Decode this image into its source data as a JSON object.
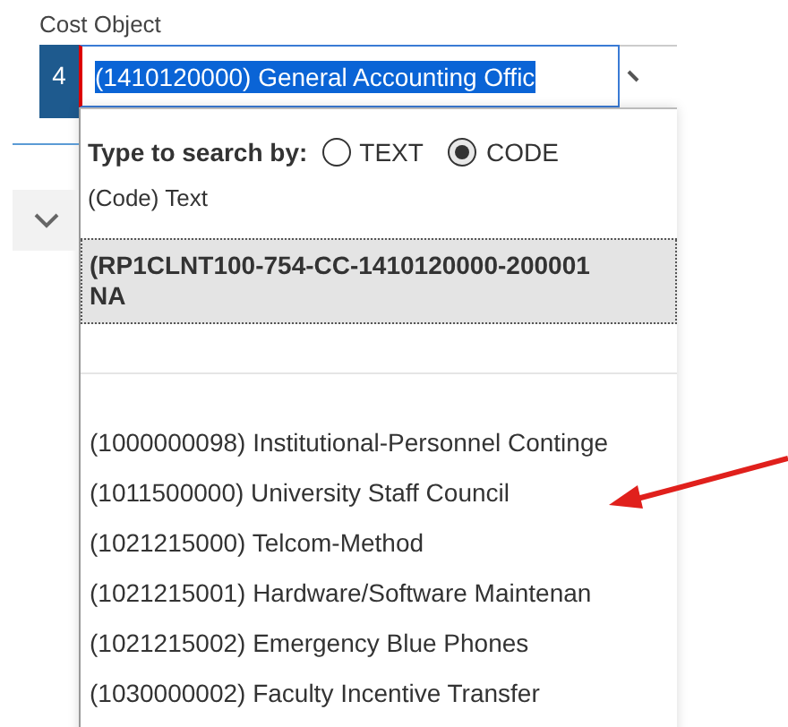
{
  "field": {
    "label": "Cost Object",
    "row_number": "4",
    "value": "(1410120000) General Accounting Offic"
  },
  "dropdown": {
    "search_label": "Type to search by:",
    "search_options": [
      {
        "label": "TEXT",
        "selected": false
      },
      {
        "label": "CODE",
        "selected": true
      }
    ],
    "header": "(Code) Text",
    "items": [
      {
        "lines": [
          "(RP1CLNT100-754-CC-1410120000-200001",
          "NA"
        ],
        "selected": true
      },
      {
        "selected": false
      },
      {
        "lines": [
          "(1000000098) Institutional-Personnel Continge"
        ],
        "selected": false
      },
      {
        "lines": [
          "(1011500000) University Staff Council"
        ],
        "selected": false
      },
      {
        "lines": [
          "(1021215000) Telcom-Method"
        ],
        "selected": false
      },
      {
        "lines": [
          "(1021215001) Hardware/Software Maintenan"
        ],
        "selected": false
      },
      {
        "lines": [
          "(1021215002) Emergency Blue Phones"
        ],
        "selected": false
      },
      {
        "lines": [
          "(1030000002) Faculty Incentive Transfer"
        ],
        "selected": false
      }
    ]
  }
}
